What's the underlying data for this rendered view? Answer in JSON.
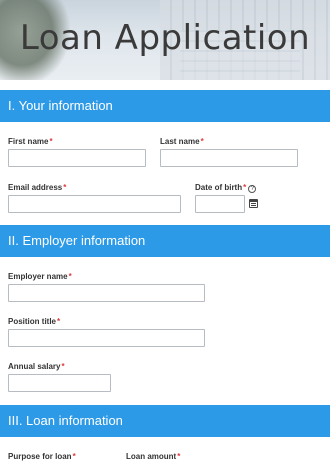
{
  "header": {
    "title": "Loan Application"
  },
  "sections": {
    "your_info": {
      "title": "I. Your information"
    },
    "employer_info": {
      "title": "II. Employer information"
    },
    "loan_info": {
      "title": "III. Loan information"
    }
  },
  "fields": {
    "first_name": {
      "label": "First name",
      "value": ""
    },
    "last_name": {
      "label": "Last name",
      "value": ""
    },
    "email": {
      "label": "Email address",
      "value": ""
    },
    "dob": {
      "label": "Date of birth",
      "value": ""
    },
    "employer_name": {
      "label": "Employer name",
      "value": ""
    },
    "position_title": {
      "label": "Position title",
      "value": ""
    },
    "annual_salary": {
      "label": "Annual salary",
      "value": ""
    },
    "purpose": {
      "label": "Purpose for loan"
    },
    "loan_amount": {
      "label": "Loan amount"
    }
  },
  "required_mark": "*",
  "help_glyph": "?",
  "icons": {
    "help": "question-circle-icon",
    "date": "calendar-icon"
  },
  "colors": {
    "section_bar": "#2d9ae8",
    "required": "#e03b3b"
  }
}
